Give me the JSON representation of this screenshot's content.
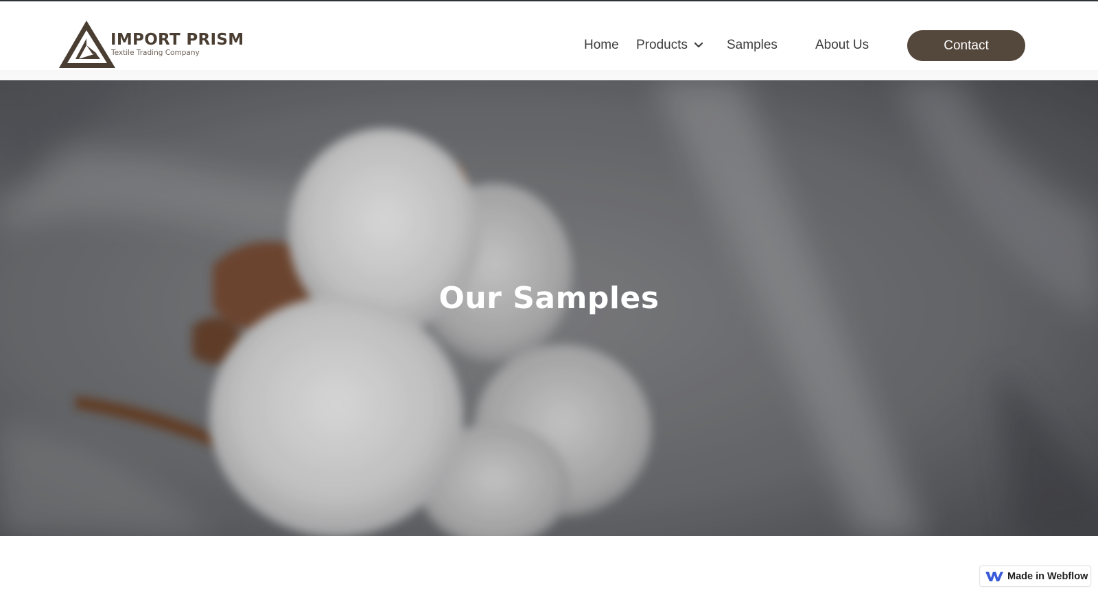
{
  "brand": {
    "name": "IMPORT PRISM",
    "tagline": "Textile Trading Company",
    "primary_color": "#54473b"
  },
  "nav": {
    "items": [
      {
        "label": "Home"
      },
      {
        "label": "Products",
        "has_dropdown": true
      },
      {
        "label": "Samples"
      },
      {
        "label": "About Us"
      }
    ],
    "contact_label": "Contact"
  },
  "hero": {
    "title": "Our Samples",
    "background": "cotton-boll-photo"
  },
  "badge": {
    "label": "Made in Webflow",
    "icon": "webflow-logo-icon"
  }
}
